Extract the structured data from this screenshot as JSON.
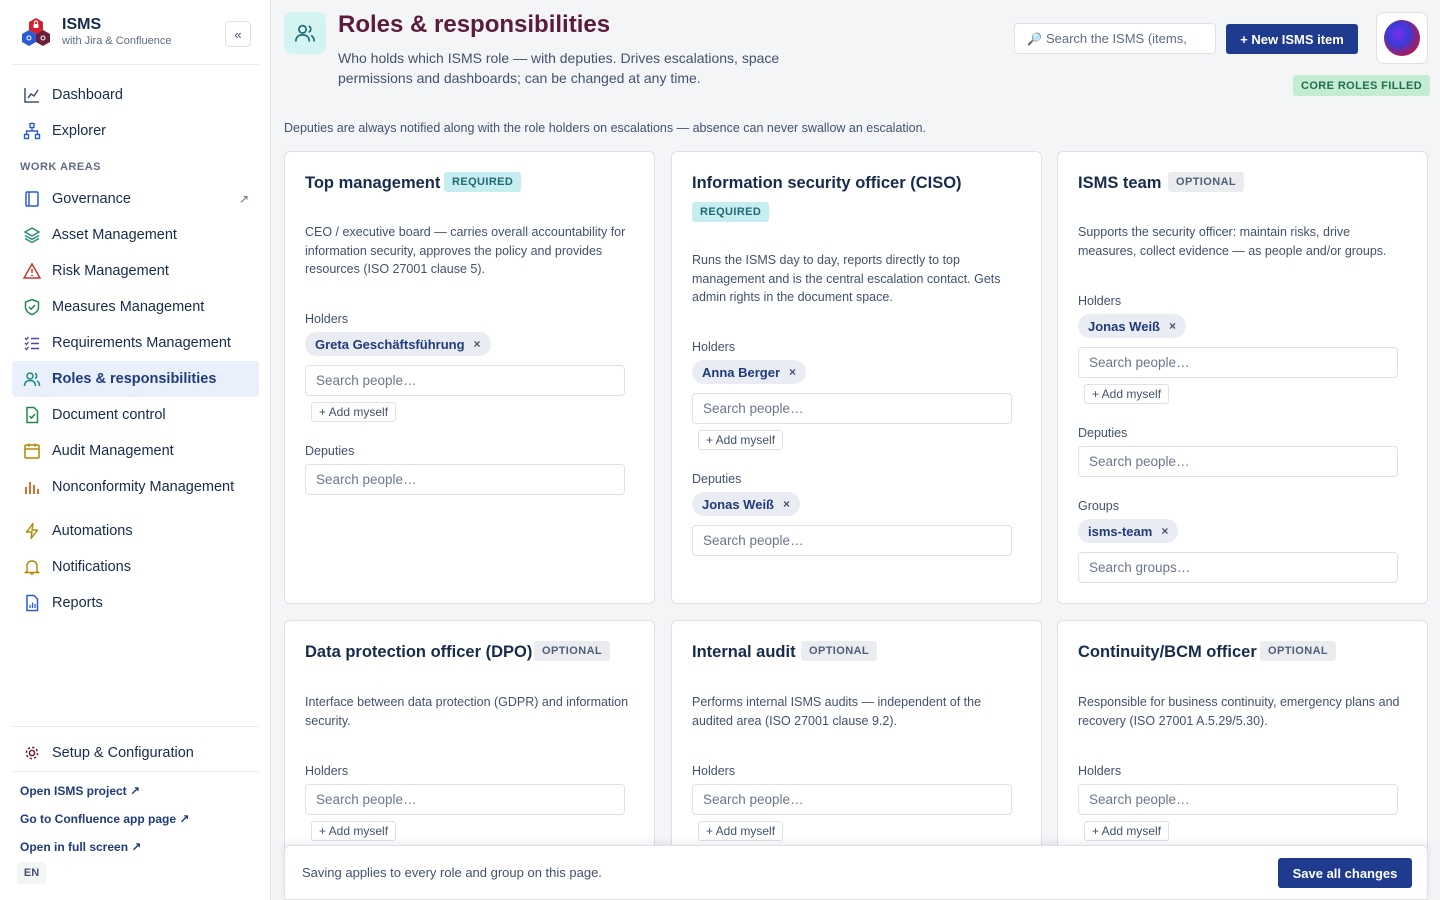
{
  "app": {
    "title": "ISMS",
    "subtitle": "with Jira & Confluence",
    "collapse": "«"
  },
  "sidebar": {
    "section_label": "WORK AREAS",
    "top_items": [
      {
        "label": "Dashboard"
      },
      {
        "label": "Explorer"
      }
    ],
    "work_items": [
      {
        "label": "Governance",
        "ext": "↗"
      },
      {
        "label": "Asset Management"
      },
      {
        "label": "Risk Management"
      },
      {
        "label": "Measures Management"
      },
      {
        "label": "Requirements Management"
      },
      {
        "label": "Roles & responsibilities"
      },
      {
        "label": "Document control"
      },
      {
        "label": "Audit Management"
      },
      {
        "label": "Nonconformity Management"
      }
    ],
    "other_items": [
      {
        "label": "Automations"
      },
      {
        "label": "Notifications"
      },
      {
        "label": "Reports"
      }
    ],
    "setup_label": "Setup & Configuration",
    "links": [
      "Open ISMS project ↗",
      "Go to Confluence app page ↗",
      "Open in full screen ↗"
    ],
    "lang": "EN"
  },
  "header": {
    "title": "Roles & responsibilities",
    "description": "Who holds which ISMS role — with deputies. Drives escalations, space permissions and dashboards; can be changed at any time.",
    "search_placeholder": "Search the ISMS (items,",
    "new_button": "+ New ISMS item",
    "status": "CORE ROLES FILLED",
    "notice": "Deputies are always notified along with the role holders on escalations — absence can never swallow an escalation."
  },
  "common": {
    "holders": "Holders",
    "deputies": "Deputies",
    "groups": "Groups",
    "search_people": "Search people…",
    "search_groups": "Search groups…",
    "add_myself": "+ Add myself",
    "remove": "×"
  },
  "cards": [
    {
      "title": "Top management",
      "badge": "REQUIRED",
      "description": "CEO / executive board — carries overall accountability for information security, approves the policy and provides resources (ISO 27001 clause 5).",
      "holders": [
        "Greta Geschäftsführung"
      ],
      "deputies": []
    },
    {
      "title": "Information security officer (CISO)",
      "badge": "REQUIRED",
      "description": "Runs the ISMS day to day, reports directly to top management and is the central escalation contact. Gets admin rights in the document space.",
      "holders": [
        "Anna Berger"
      ],
      "deputies": [
        "Jonas Weiß"
      ]
    },
    {
      "title": "ISMS team",
      "badge": "OPTIONAL",
      "description": "Supports the security officer: maintain risks, drive measures, collect evidence — as people and/or groups.",
      "holders": [
        "Jonas Weiß"
      ],
      "deputies": [],
      "groups": [
        "isms-team"
      ]
    },
    {
      "title": "Data protection officer (DPO)",
      "badge": "OPTIONAL",
      "description": "Interface between data protection (GDPR) and information security.",
      "holders": []
    },
    {
      "title": "Internal audit",
      "badge": "OPTIONAL",
      "description": "Performs internal ISMS audits — independent of the audited area (ISO 27001 clause 9.2).",
      "holders": []
    },
    {
      "title": "Continuity/BCM officer",
      "badge": "OPTIONAL",
      "description": "Responsible for business continuity, emergency plans and recovery (ISO 27001 A.5.29/5.30).",
      "holders": []
    }
  ],
  "footer": {
    "text": "Saving applies to every role and group on this page.",
    "save_button": "Save all changes"
  },
  "colors": {
    "primary": "#1f3b8f",
    "title": "#5c1a3c",
    "required_badge": "#c6eef0",
    "success_badge": "#c3ecd3"
  }
}
